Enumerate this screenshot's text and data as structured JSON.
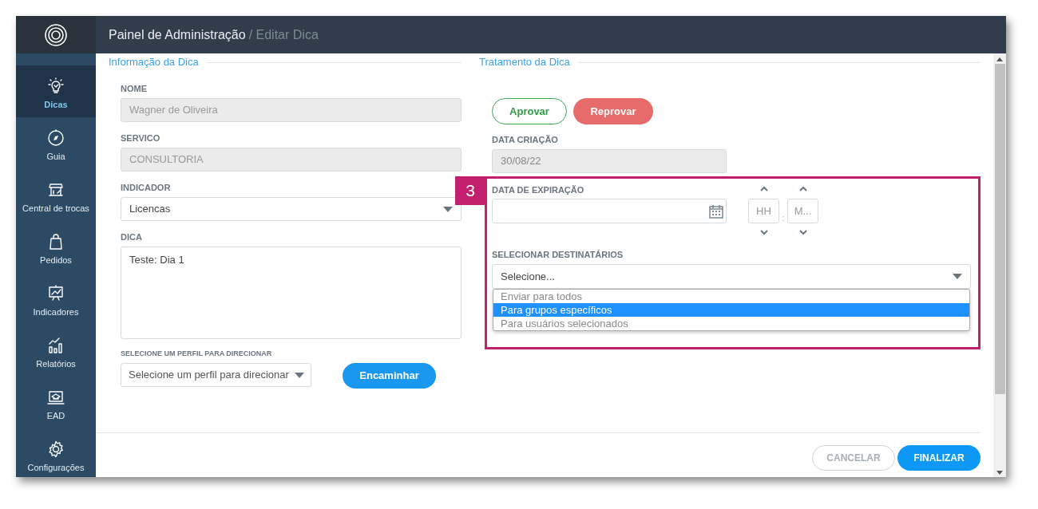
{
  "header": {
    "title": "Painel de Administração",
    "subtitle": "/ Editar Dica"
  },
  "sidebar": {
    "items": [
      {
        "label": "Dicas",
        "selected": true
      },
      {
        "label": "Guia",
        "selected": false
      },
      {
        "label": "Central de trocas",
        "selected": false
      },
      {
        "label": "Pedidos",
        "selected": false
      },
      {
        "label": "Indicadores",
        "selected": false
      },
      {
        "label": "Relatórios",
        "selected": false
      },
      {
        "label": "EAD",
        "selected": false
      },
      {
        "label": "Configurações",
        "selected": false
      }
    ]
  },
  "tip_info": {
    "legend": "Informação da Dica",
    "fields": [
      {
        "kind": "input",
        "label": "NOME",
        "value": "Wagner de Oliveira",
        "disabled": true
      },
      {
        "kind": "input",
        "label": "SERVICO",
        "value": "CONSULTORIA",
        "disabled": true
      },
      {
        "kind": "select",
        "label": "INDICADOR",
        "value": "Licencas",
        "disabled": false
      },
      {
        "kind": "textarea",
        "label": "DICA",
        "value": "Teste: Dia 1",
        "disabled": false
      }
    ],
    "profile": {
      "label": "SELECIONE UM PERFIL PARA DIRECIONAR",
      "value": "Selecione um perfil para direcionar"
    },
    "forward_button": "Encaminhar"
  },
  "tip_handling": {
    "legend": "Tratamento da Dica",
    "buttons": [
      {
        "label": "Aprovar",
        "kind": "approve"
      },
      {
        "label": "Reprovar",
        "kind": "reject"
      }
    ],
    "created": {
      "label": "DATA CRIAÇÃO",
      "value": "30/08/22"
    },
    "expiration": {
      "label": "DATA DE EXPIRAÇÃO",
      "hour_placeholder": "HH",
      "separator": ":",
      "minute_placeholder": "M..."
    },
    "recipients": {
      "label": "SELECIONAR DESTINATÁRIOS",
      "value": "Selecione...",
      "options": [
        {
          "label": "Enviar para todos",
          "selected": false
        },
        {
          "label": "Para grupos específicos",
          "selected": true
        },
        {
          "label": "Para usuários selecionados",
          "selected": false
        }
      ]
    }
  },
  "annotation": {
    "number": "3"
  },
  "footer": {
    "buttons": [
      {
        "label": "CANCELAR",
        "kind": "secondary"
      },
      {
        "label": "FINALIZAR",
        "kind": "primary"
      }
    ]
  }
}
